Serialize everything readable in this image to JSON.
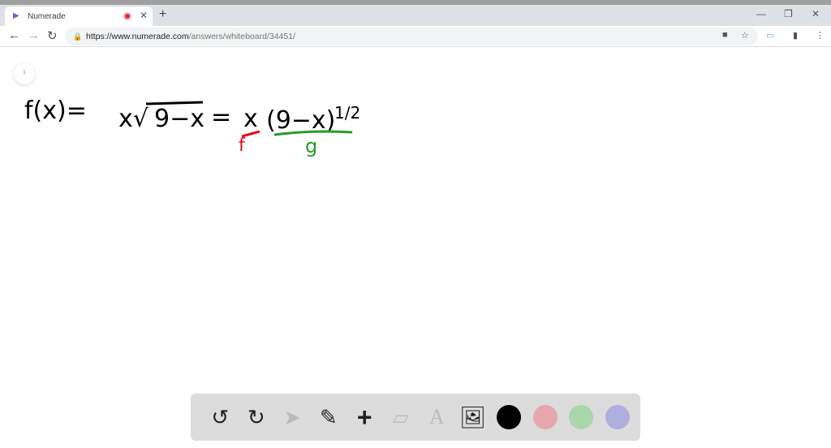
{
  "browser": {
    "tab_title": "Numerade",
    "url_host": "https://www.numerade.com",
    "url_path": "/answers/whiteboard/34451/"
  },
  "whiteboard": {
    "page_number": "1",
    "lhs": "f(x)=",
    "expr1": "x√",
    "radicand": "9−x",
    "eq": "=",
    "x_term": "x",
    "x_label": "f",
    "paren": "(9−x)",
    "exponent": "1/2",
    "paren_label": "g"
  },
  "toolbar": {
    "tools": [
      "undo",
      "redo",
      "select",
      "pencil",
      "add",
      "eraser",
      "text",
      "image"
    ],
    "colors": [
      "#000000",
      "#e8a6ad",
      "#a9d6aa",
      "#b0addf"
    ]
  }
}
